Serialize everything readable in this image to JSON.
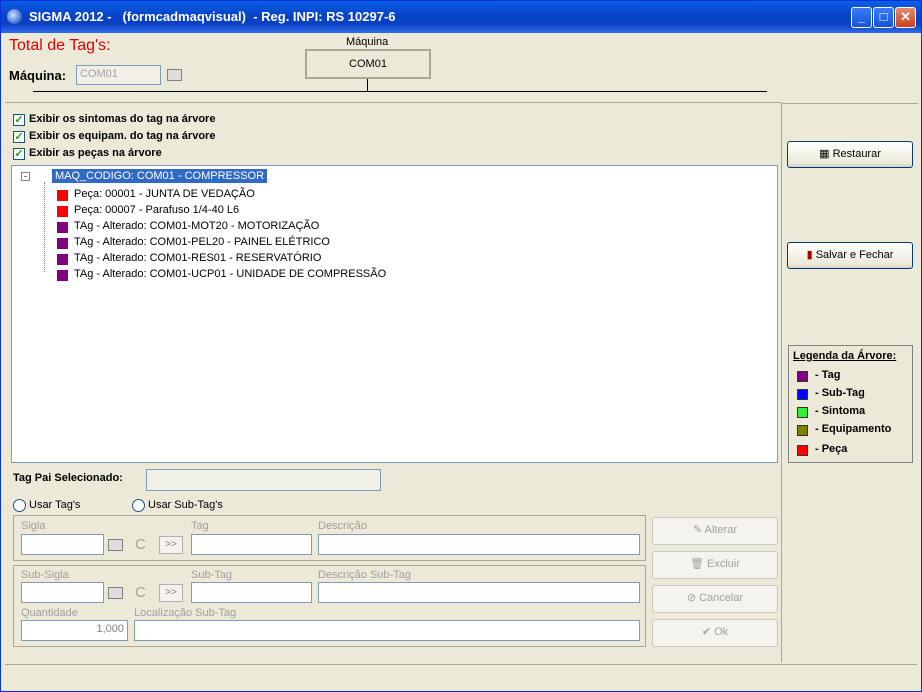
{
  "window": {
    "title": "SIGMA 2012 -   (formcadmaqvisual)  - Reg. INPI: RS 10297-6",
    "min": "_",
    "max": "□",
    "close": "✕"
  },
  "header": {
    "total_tags": "Total de Tag's:",
    "maquina_label": "Máquina:",
    "maquina_value": "COM01",
    "group_caption": "Máquina",
    "group_value": "COM01"
  },
  "options": {
    "show_symptoms": "Exibir os sintomas do tag na árvore",
    "show_equipment": "Exibir os equipam. do tag na árvore",
    "show_parts": "Exibir as peças na árvore"
  },
  "tree": {
    "root": "MAQ_CODIGO: COM01 - COMPRESSOR",
    "nodes": [
      {
        "text": "Peça: 00001 - JUNTA DE VEDAÇÃO",
        "color": "#ff0000"
      },
      {
        "text": "Peça: 00007 - Parafuso 1/4-40 L6",
        "color": "#ff0000"
      },
      {
        "text": "TAg - Alterado: COM01-MOT20 - MOTORIZAÇÃO",
        "color": "#800080"
      },
      {
        "text": "TAg - Alterado: COM01-PEL20 - PAINEL ELÉTRICO",
        "color": "#800080"
      },
      {
        "text": "TAg - Alterado: COM01-RES01 - RESERVATÓRIO",
        "color": "#800080"
      },
      {
        "text": "TAg - Alterado: COM01-UCP01 - UNIDADE DE COMPRESSÃO",
        "color": "#800080"
      }
    ]
  },
  "form": {
    "tag_pai": "Tag Pai Selecionado:",
    "usar_tags": "Usar Tag's",
    "usar_subtags": "Usar Sub-Tag's",
    "sigla": "Sigla",
    "tag": "Tag",
    "descricao": "Descrição",
    "sub_sigla": "Sub-Sigla",
    "sub_tag": "Sub-Tag",
    "descricao_sub_tag": "Descrição Sub-Tag",
    "quantidade": "Quantidade",
    "quantidade_value": "1,000",
    "localizacao": "Localização Sub-Tag",
    "c": "C",
    "arrows": ">>"
  },
  "actions": {
    "alterar": "Alterar",
    "excluir": "Excluir",
    "cancelar": "Cancelar",
    "ok": "Ok",
    "restaurar": "Restaurar",
    "salvar": "Salvar e Fechar"
  },
  "legend": {
    "title": "Legenda da Árvore:",
    "items": [
      {
        "label": "- Tag",
        "color": "#800080"
      },
      {
        "label": "- Sub-Tag",
        "color": "#0000ff"
      },
      {
        "label": "- Sintoma",
        "color": "#33ee33"
      },
      {
        "label": "- Equipamento",
        "color": "#808000"
      },
      {
        "label": "- Peça",
        "color": "#ff0000"
      }
    ]
  }
}
